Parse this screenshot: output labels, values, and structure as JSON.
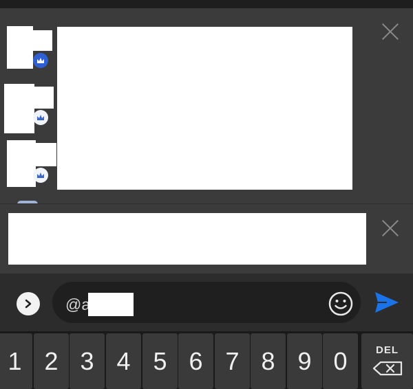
{
  "input": {
    "value": "@a"
  },
  "keyboard": {
    "keys": [
      "1",
      "2",
      "3",
      "4",
      "5",
      "6",
      "7",
      "8",
      "9",
      "0"
    ],
    "del_label": "DEL"
  },
  "icons": {
    "close": "close-icon",
    "expand": "chevron-right-icon",
    "emoji": "smiley-icon",
    "send": "send-icon",
    "badge": "crown-icon",
    "backspace": "backspace-icon"
  },
  "colors": {
    "panel": "#3b3b3b",
    "badge_blue": "#2f5fd0",
    "send_blue": "#1a73e8"
  }
}
